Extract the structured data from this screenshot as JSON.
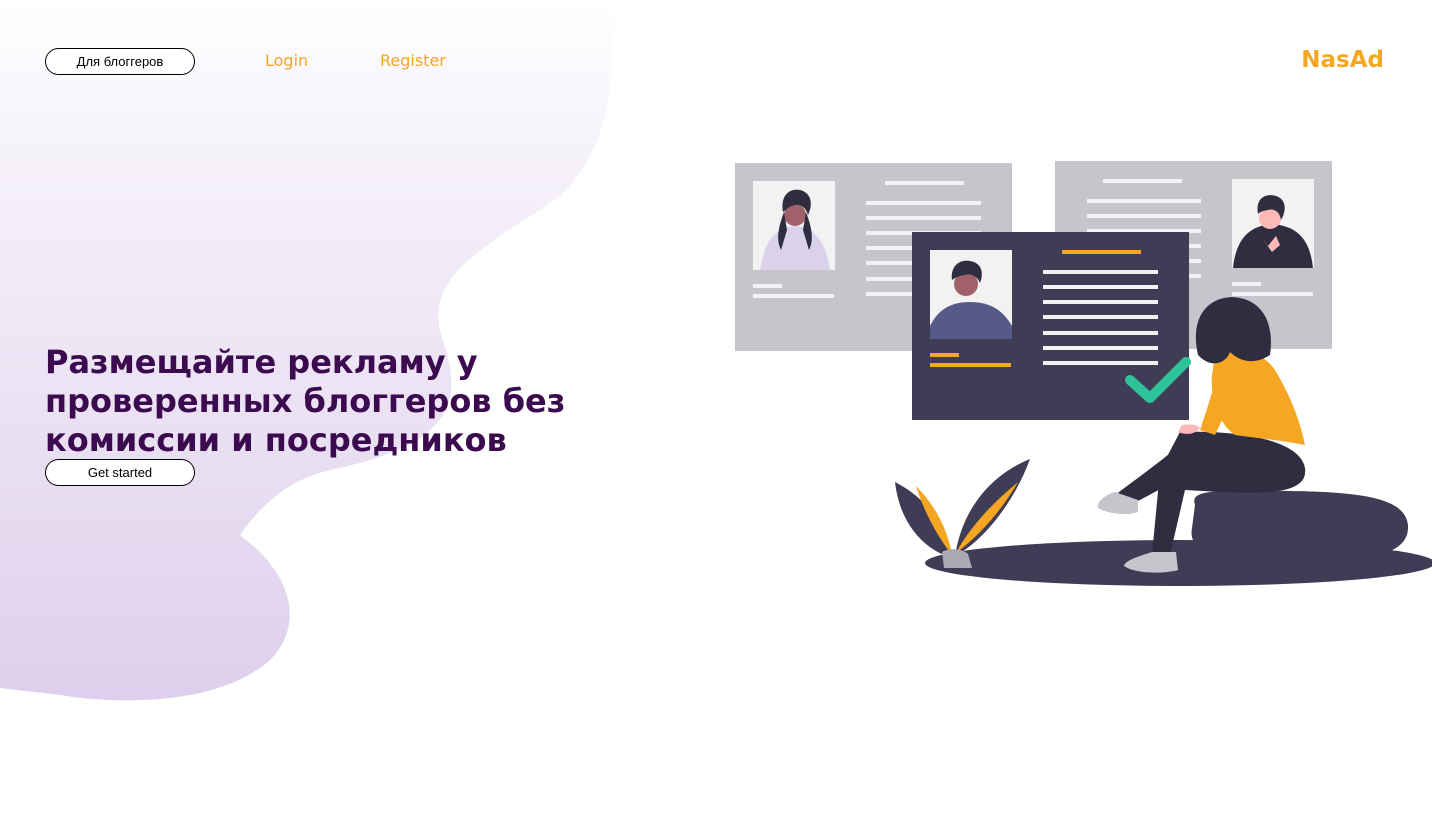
{
  "nav": {
    "bloggers_label": "Для блоггеров",
    "login_label": "Login",
    "register_label": "Register"
  },
  "brand": {
    "logo": "NasAd"
  },
  "hero": {
    "headline": "Размещайте рекламу у проверенных блоггеров без комиссии и посредников",
    "cta_label": "Get started"
  },
  "colors": {
    "accent": "#f5a623",
    "heading": "#3b0a4f",
    "blob_light": "#f8f5fb",
    "blob_dark": "#decfec",
    "illustration_dark": "#3f3d56",
    "illustration_gray": "#c6c5cc",
    "check": "#2ec39b"
  },
  "icons": {
    "illustration": "people-profiles-illustration",
    "check": "check-icon"
  }
}
